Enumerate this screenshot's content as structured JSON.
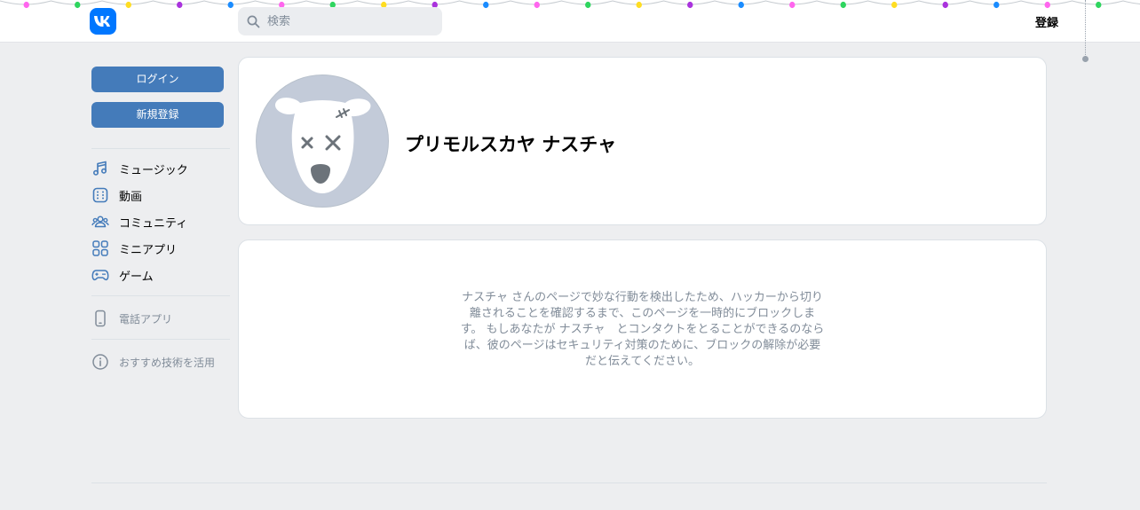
{
  "header": {
    "search_placeholder": "検索",
    "register_label": "登録"
  },
  "garland": {
    "colors": [
      "#ff66ee",
      "#2fd55f",
      "#ffdd22",
      "#aa33dd",
      "#1a8cff"
    ]
  },
  "sidebar": {
    "login_label": "ログイン",
    "signup_label": "新規登録",
    "nav": [
      {
        "label": "ミュージック",
        "icon": "music-icon"
      },
      {
        "label": "動画",
        "icon": "video-icon"
      },
      {
        "label": "コミュニティ",
        "icon": "community-icon"
      },
      {
        "label": "ミニアプリ",
        "icon": "mini-apps-icon"
      },
      {
        "label": "ゲーム",
        "icon": "gamepad-icon"
      }
    ],
    "phone_app_label": "電話アプリ",
    "recommended_tech_label": "おすすめ技術を活用"
  },
  "profile": {
    "name": "プリモルスカヤ ナスチャ"
  },
  "blocked_message": "ナスチャ さんのページで妙な行動を検出したため、ハッカーから切り離されることを確認するまで、このページを一時的にブロックします。 もしあなたが ナスチャ　とコンタクトをとることができるのならば、彼のページはセキュリティ対策のために、ブロックの解除が必要だと伝えてください。",
  "colors": {
    "accent": "#447bba",
    "brand": "#0077ff",
    "background": "#edeef0",
    "muted_text": "#818c99"
  }
}
